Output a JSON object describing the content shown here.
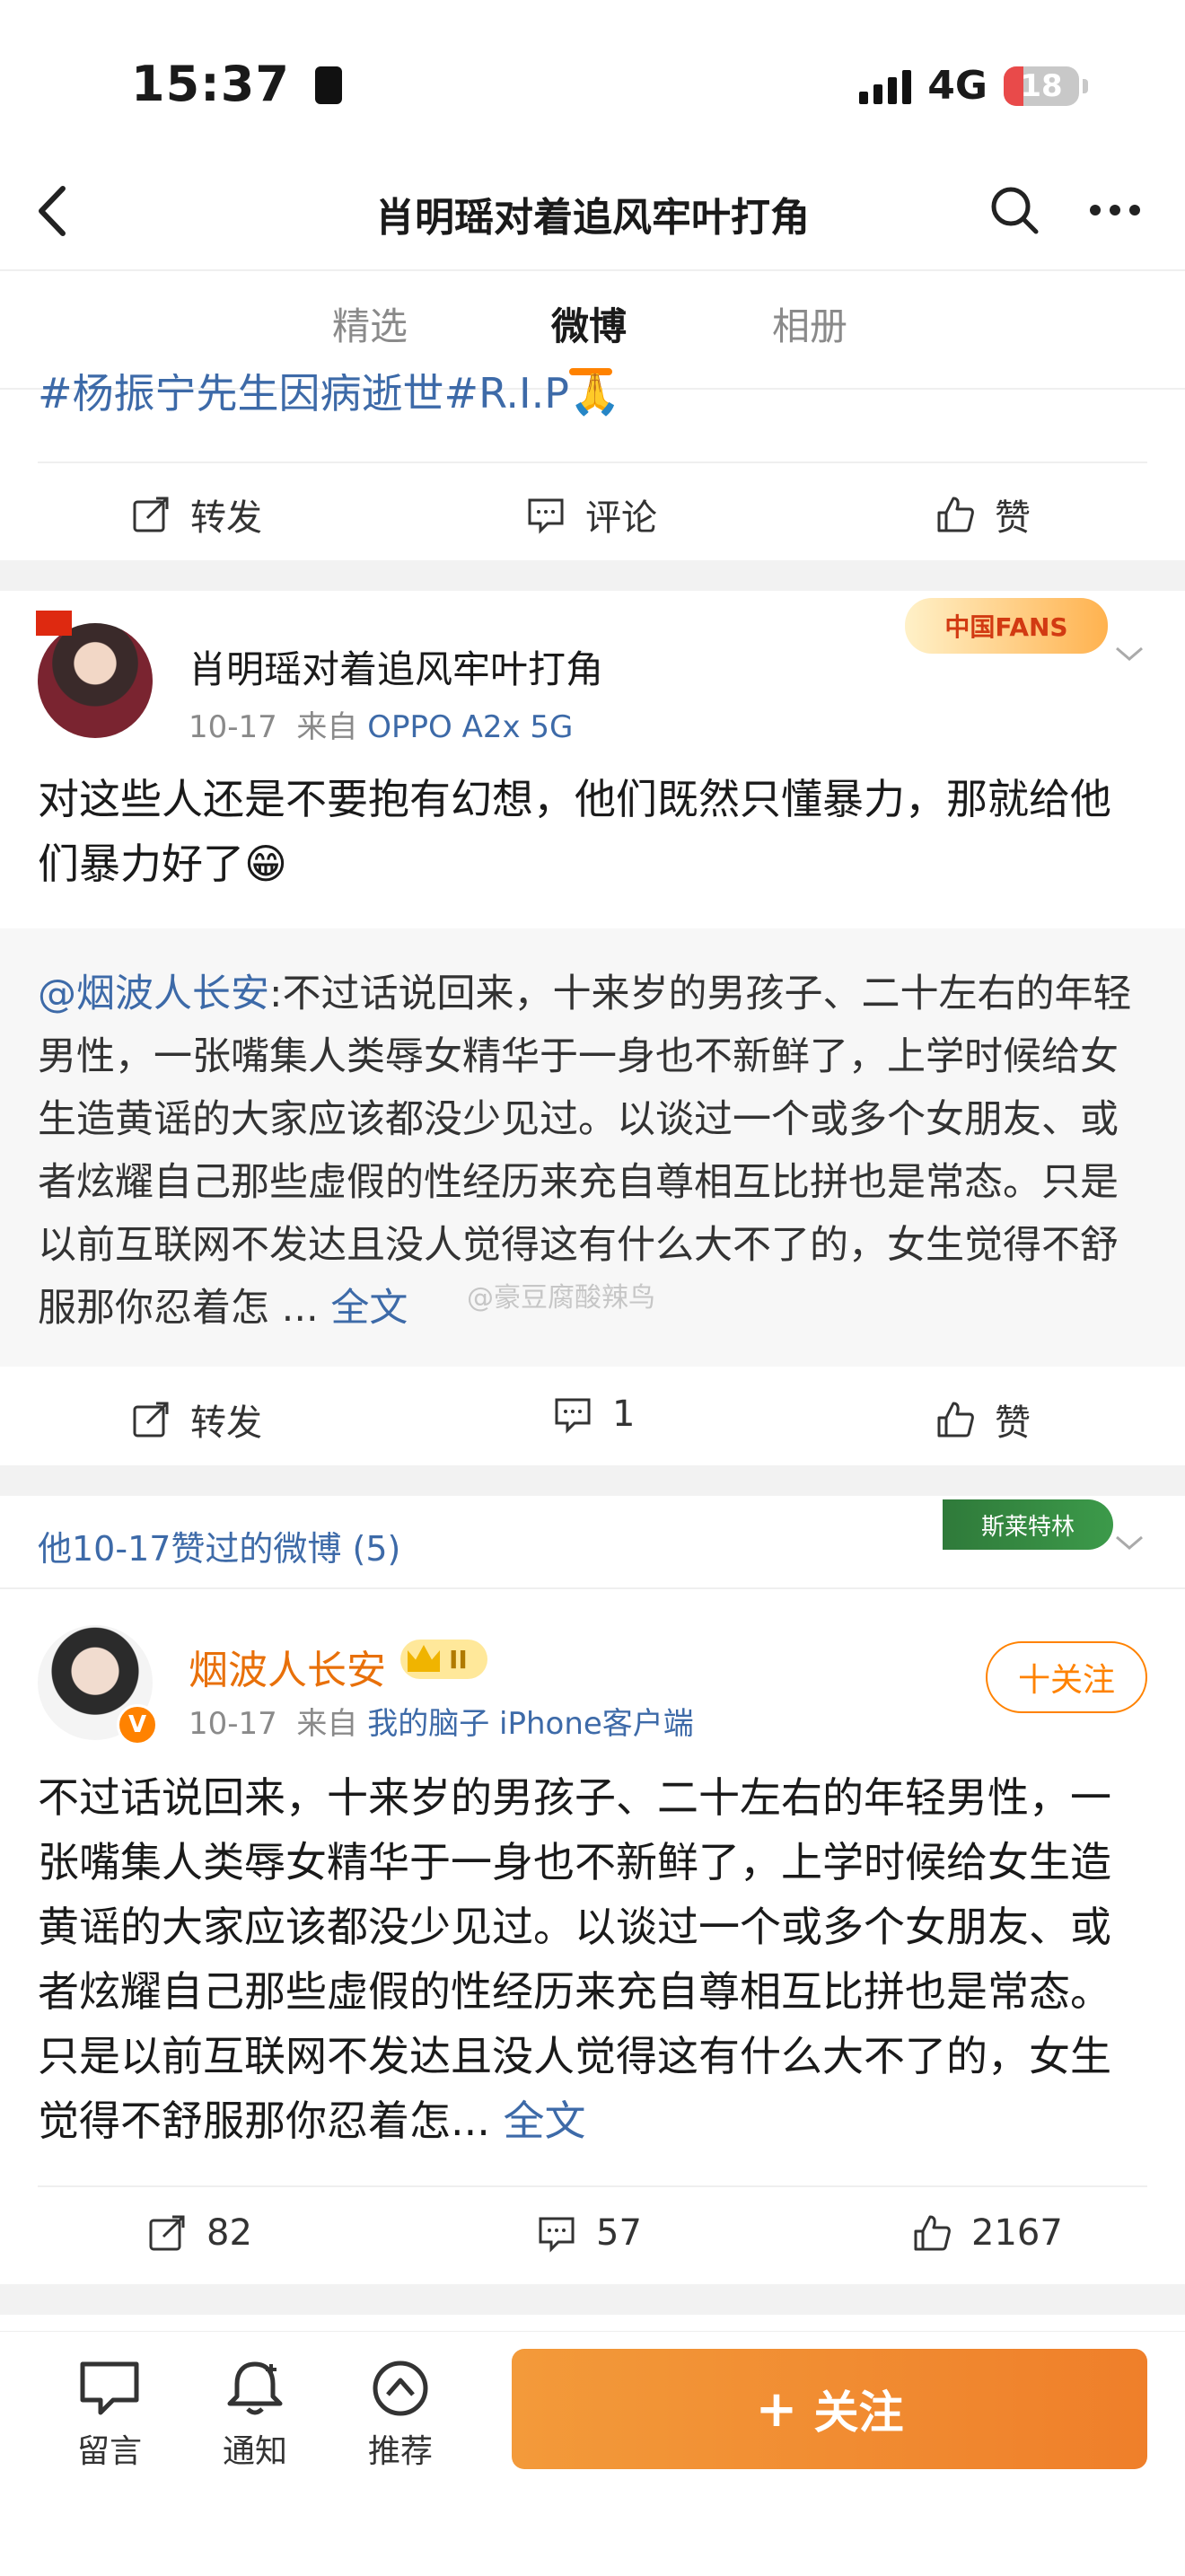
{
  "status_bar": {
    "time": "15:37",
    "network": "4G",
    "battery": "18"
  },
  "nav": {
    "title": "肖明瑶对着追风牢叶打角"
  },
  "tabs": [
    {
      "label": "精选"
    },
    {
      "label": "微博"
    },
    {
      "label": "相册"
    }
  ],
  "post0": {
    "partial_text": "#杨振宁先生因病逝世#R.I.P🙏",
    "actions": {
      "repost": "转发",
      "comment": "评论",
      "like": "赞"
    }
  },
  "post1": {
    "author": "肖明瑶对着追风牢叶打角",
    "date": "10-17",
    "source_prefix": "来自",
    "source": "OPPO A2x 5G",
    "badge": "中国FANS",
    "text": "对这些人还是不要抱有幻想，他们既然只懂暴力，那就给他们暴力好了😁",
    "quote_author": "@烟波人长安",
    "quote_text": ":不过话说回来，十来岁的男孩子、二十左右的年轻男性，一张嘴集人类辱女精华于一身也不新鲜了，上学时候给女生造黄谣的大家应该都没少见过。以谈过一个或多个女朋友、或者炫耀自己那些虚假的性经历来充自尊相互比拼也是常态。只是以前互联网不发达且没人觉得这有什么大不了的，女生觉得不舒服那你忍着怎 ...",
    "quote_more": "全文",
    "watermark": "@豪豆腐酸辣鸟",
    "actions": {
      "repost": "转发",
      "comment": "1",
      "like": "赞"
    }
  },
  "liked_section": {
    "label": "他10-17赞过的微博 (5)",
    "badge": "斯莱特林"
  },
  "post2": {
    "author": "烟波人长安",
    "level": "II",
    "date": "10-17",
    "source_prefix": "来自",
    "source": "我的脑子 iPhone客户端",
    "follow": "十关注",
    "text": "不过话说回来，十来岁的男孩子、二十左右的年轻男性，一张嘴集人类辱女精华于一身也不新鲜了，上学时候给女生造黄谣的大家应该都没少见过。以谈过一个或多个女朋友、或者炫耀自己那些虚假的性经历来充自尊相互比拼也是常态。只是以前互联网不发达且没人觉得这有什么大不了的，女生觉得不舒服那你忍着怎...",
    "more": "全文",
    "actions": {
      "repost": "82",
      "comment": "57",
      "like": "2167"
    }
  },
  "bottom_bar": {
    "message": "留言",
    "notify": "通知",
    "recommend": "推荐",
    "follow": "关注"
  },
  "colors": {
    "accent": "#ff8200",
    "link": "#3d6aa8"
  }
}
